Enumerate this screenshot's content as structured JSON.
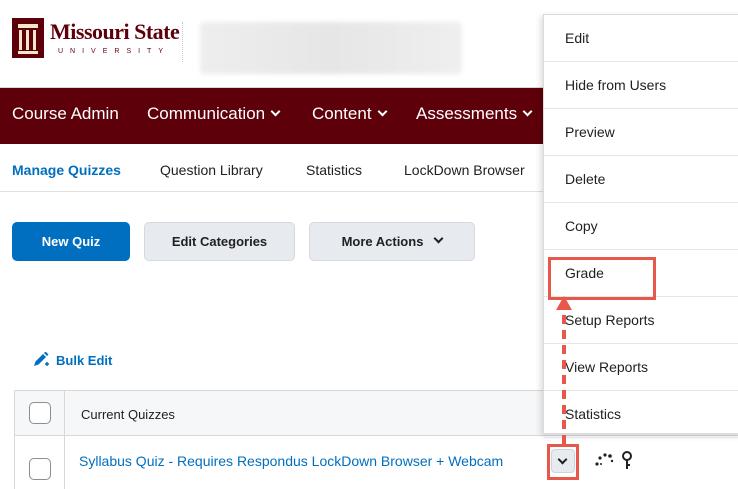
{
  "header": {
    "logo_name": "Missouri State",
    "logo_subtitle": "UNIVERSITY",
    "colors": {
      "brand": "#5e0009",
      "accent": "#006fbf",
      "annotation": "#e8574b"
    }
  },
  "navbar": {
    "items": [
      {
        "label": "Course Admin",
        "has_dropdown": false
      },
      {
        "label": "Communication",
        "has_dropdown": true
      },
      {
        "label": "Content",
        "has_dropdown": true
      },
      {
        "label": "Assessments",
        "has_dropdown": true
      }
    ]
  },
  "tabs": [
    {
      "label": "Manage Quizzes",
      "active": true
    },
    {
      "label": "Question Library",
      "active": false
    },
    {
      "label": "Statistics",
      "active": false
    },
    {
      "label": "LockDown Browser",
      "active": false
    }
  ],
  "toolbar": {
    "new_quiz": "New Quiz",
    "edit_categories": "Edit Categories",
    "more_actions": "More Actions"
  },
  "bulk_edit": {
    "label": "Bulk Edit",
    "icon": "pencil-icon"
  },
  "table": {
    "header": "Current Quizzes",
    "rows": [
      {
        "title": "Syllabus Quiz - Requires Respondus LockDown Browser + Webcam",
        "icons": [
          "chevron-down-icon",
          "loading-dots-icon",
          "key-icon"
        ]
      }
    ]
  },
  "context_menu": {
    "items": [
      "Edit",
      "Hide from Users",
      "Preview",
      "Delete",
      "Copy",
      "Grade",
      "Setup Reports",
      "View Reports",
      "Statistics"
    ],
    "highlighted": "Grade"
  }
}
